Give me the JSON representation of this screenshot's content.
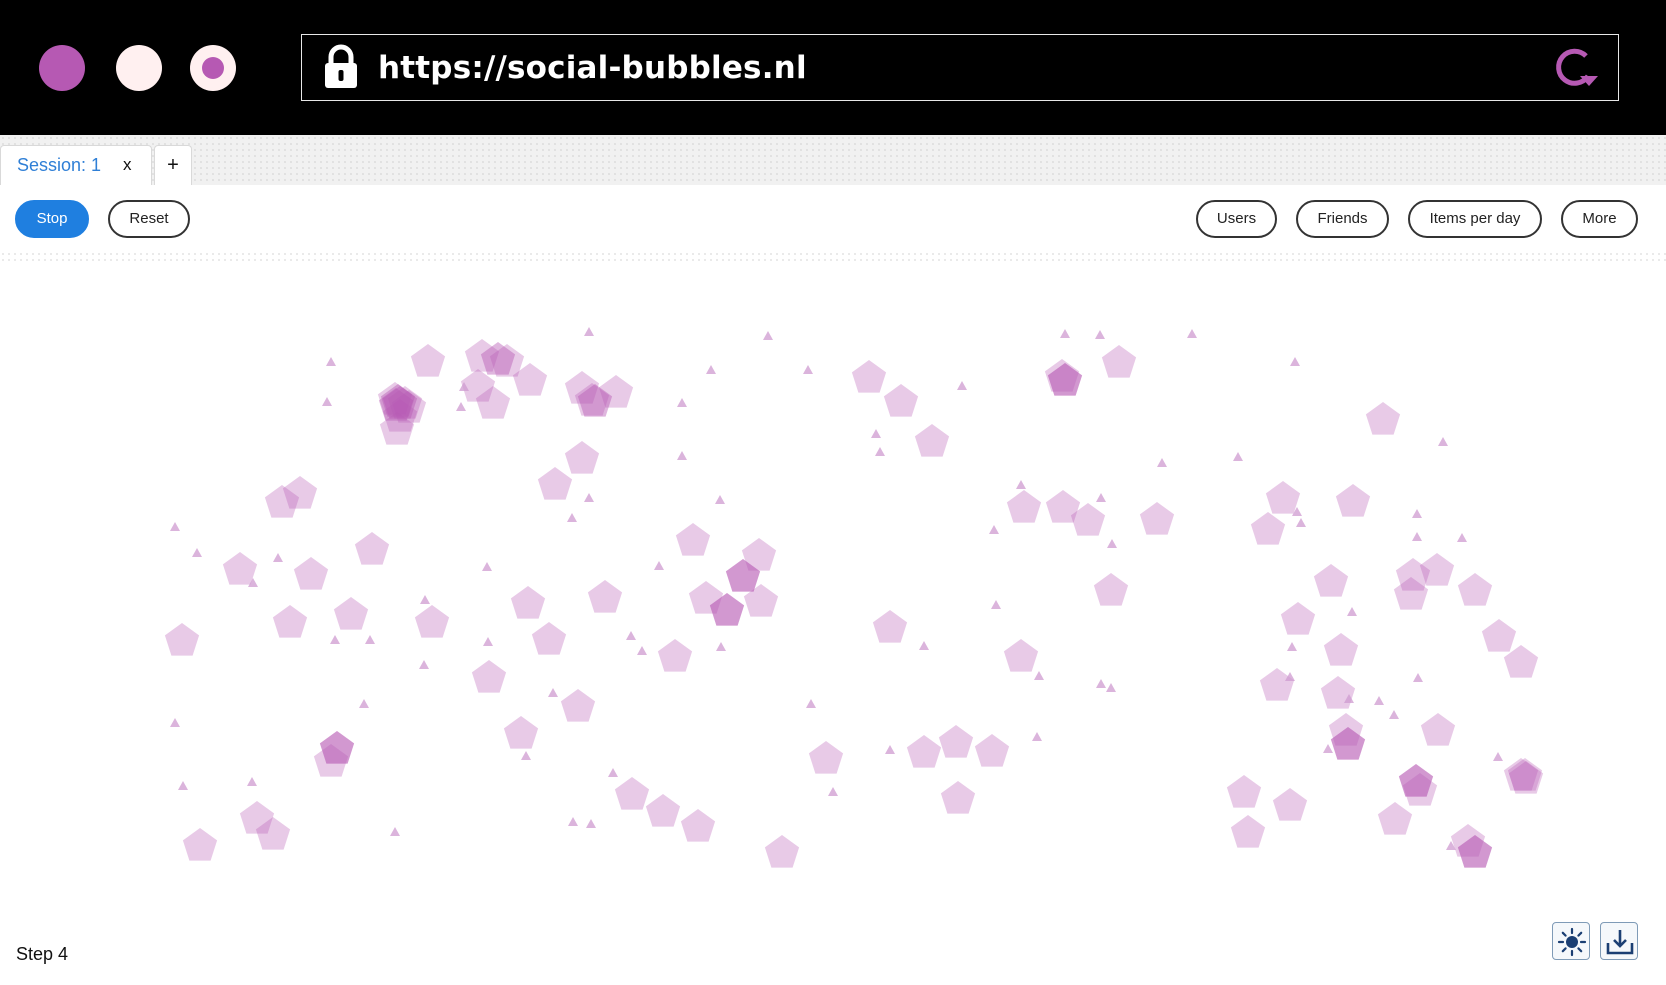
{
  "browser": {
    "url": "https://social-bubbles.nl",
    "colors": {
      "accent": "#b659b3",
      "light": "#fff0f0"
    }
  },
  "tabs": {
    "session_label": "Session: 1",
    "close_label": "x",
    "add_label": "+"
  },
  "toolbar": {
    "stop_label": "Stop",
    "reset_label": "Reset",
    "users_label": "Users",
    "friends_label": "Friends",
    "items_label": "Items per day",
    "more_label": "More"
  },
  "simulation": {
    "node_color": "#b659b3",
    "node_opacity": 0.32,
    "item_color": "#cf9bd0"
  },
  "footer": {
    "step_label": "Step 4",
    "icons": [
      "sun-icon",
      "download-icon"
    ]
  }
}
